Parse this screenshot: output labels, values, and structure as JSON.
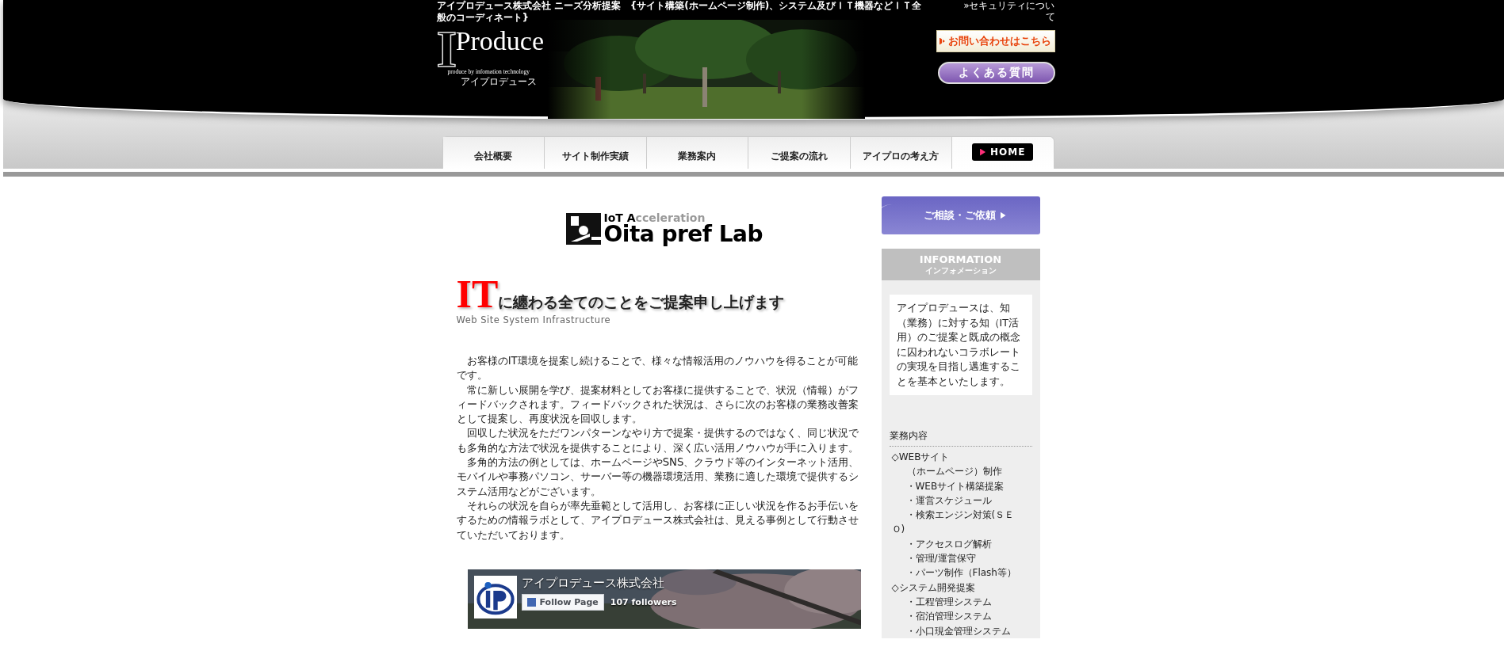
{
  "header": {
    "top_text": "アイプロデュース株式会社 ニーズ分析提案　{サイト構築(ホームページ制作)、システム及びＩＴ機器などＩＴ全般のコーディネート}",
    "security_link": "»セキュリティについて",
    "logo": {
      "initial": "I",
      "name": "Produce",
      "tagline": "produce by infomation technology",
      "kana": "アイプロデュース"
    },
    "contact_button": "お問い合わせはこちら",
    "faq_button": "よくある質問"
  },
  "nav": [
    {
      "label": "会社概要",
      "kind": "tab"
    },
    {
      "label": "サイト制作実績",
      "kind": "tab"
    },
    {
      "label": "業務案内",
      "kind": "tab"
    },
    {
      "label": "ご提案の流れ",
      "kind": "tab"
    },
    {
      "label": "アイプロの考え方",
      "kind": "tab"
    },
    {
      "label": "HOME",
      "kind": "home"
    }
  ],
  "main": {
    "lab_logo": {
      "lead": "IoT A",
      "rest": "cceleration",
      "name": "Oita pref Lab"
    },
    "heading": {
      "big": "IT",
      "rest": "に纏わる全てのことをご提案申し上げます",
      "subtitle": "Web Site System Infrastructure"
    },
    "paragraphs": [
      "お客様のIT環境を提案し続けることで、様々な情報活用のノウハウを得ることが可能です。",
      "常に新しい展開を学び、提案材料としてお客様に提供することで、状況（情報）がフィードバックされます。フィードバックされた状況は、さらに次のお客様の業務改善案として提案し、再度状況を回収します。",
      "回収した状況をただワンパターンなやり方で提案・提供するのではなく、同じ状況でも多角的な方法で状況を提供することにより、深く広い活用ノウハウが手に入ります。",
      "多角的方法の例としては、ホームページやSNS、クラウド等のインターネット活用、モバイルや事務パソコン、サーバー等の機器環境活用、業務に適した環境で提供するシステム活用などがございます。",
      "それらの状況を自らが率先垂範として活用し、お客様に正しい状況を作るお手伝いをするための情報ラボとして、アイプロデュース株式会社は、見える事例として行動させていただいております。"
    ],
    "facebook": {
      "page_name": "アイプロデュース株式会社",
      "follow_button": "Follow Page",
      "followers": "107 followers"
    }
  },
  "sidebar": {
    "consult_button": "ご相談・ご依頼",
    "info_title": "INFORMATION",
    "info_subtitle": "インフォメーション",
    "info_text": "アイプロデュースは、知（業務）に対する知（IT活用）のご提案と既成の概念に囚われないコラボレートの実現を目指し邁進することを基本といたします。",
    "services_heading": "業務内容",
    "services": [
      {
        "lines": [
          "◇WEBサイト",
          "（ホームページ）制作"
        ],
        "children": [
          {
            "label": "・WEBサイト構築提案"
          },
          {
            "label": "・運営スケジュール"
          },
          {
            "label": "・検索エンジン対策(ＳＥＯ)"
          },
          {
            "label": "・アクセスログ解析"
          },
          {
            "label": "・管理/運営保守"
          },
          {
            "label": "・パーツ制作（Flash等）"
          }
        ]
      },
      {
        "lines": [
          "◇システム開発提案"
        ],
        "children": [
          {
            "label": "・工程管理システム"
          },
          {
            "label": "・宿泊管理システム"
          },
          {
            "label": "・小口現金管理システム"
          }
        ]
      }
    ]
  }
}
